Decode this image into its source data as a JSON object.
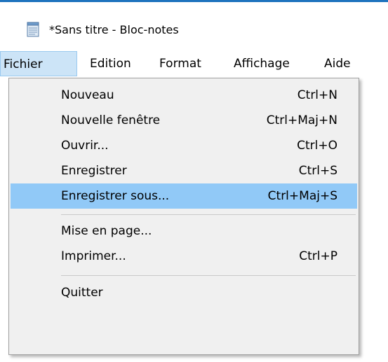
{
  "window": {
    "title": "*Sans titre - Bloc-notes",
    "icon": "notepad-icon"
  },
  "menubar": [
    {
      "label": "Fichier",
      "active": true
    },
    {
      "label": "Edition",
      "active": false
    },
    {
      "label": "Format",
      "active": false
    },
    {
      "label": "Affichage",
      "active": false
    },
    {
      "label": "Aide",
      "active": false
    }
  ],
  "file_menu": [
    {
      "label": "Nouveau",
      "shortcut": "Ctrl+N"
    },
    {
      "label": "Nouvelle fenêtre",
      "shortcut": "Ctrl+Maj+N"
    },
    {
      "label": "Ouvrir...",
      "shortcut": "Ctrl+O"
    },
    {
      "label": "Enregistrer",
      "shortcut": "Ctrl+S"
    },
    {
      "label": "Enregistrer sous...",
      "shortcut": "Ctrl+Maj+S",
      "highlighted": true
    },
    {
      "label": "Mise en page...",
      "shortcut": ""
    },
    {
      "label": "Imprimer...",
      "shortcut": "Ctrl+P"
    },
    {
      "label": "Quitter",
      "shortcut": ""
    }
  ],
  "colors": {
    "highlight": "#91c9f7",
    "active_menu": "#cce4f7",
    "menu_bg": "#f0f0f0"
  }
}
